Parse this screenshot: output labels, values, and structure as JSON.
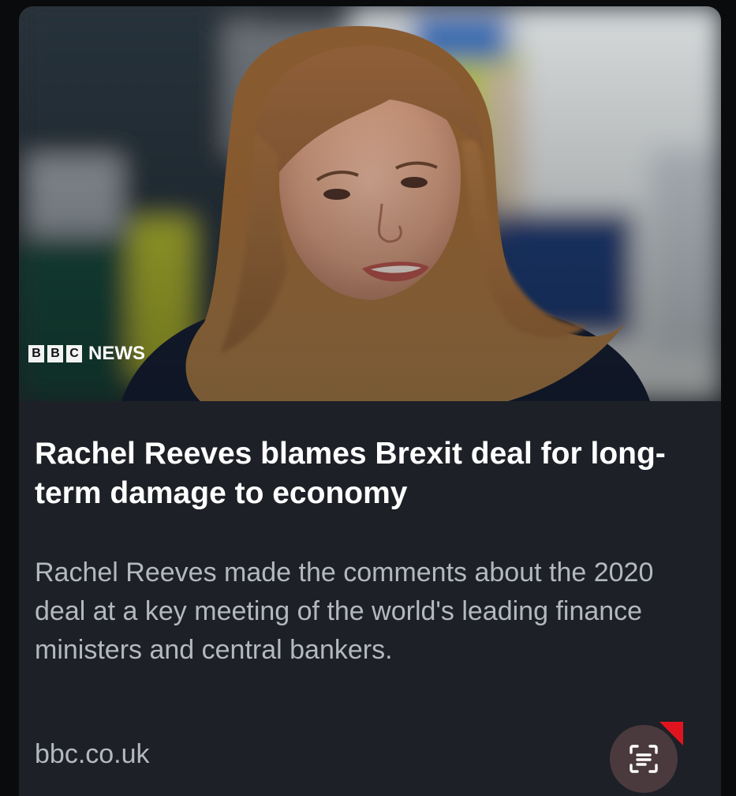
{
  "article": {
    "image_alt": "Rachel Reeves",
    "brand": {
      "letters": [
        "B",
        "B",
        "C"
      ],
      "suffix": "NEWS"
    },
    "headline": "Rachel Reeves blames Brexit deal for long-term damage to economy",
    "summary": "Rachel Reeves made the comments about the 2020 deal at a key meeting of the world's leading finance ministers and central bankers.",
    "source": "bbc.co.uk"
  },
  "overlay": {
    "icon": "scan-text-icon",
    "accent_color": "#e0141e"
  },
  "colors": {
    "card_background": "#1d2026",
    "headline": "#ffffff",
    "body_text": "#b4b8bf"
  }
}
